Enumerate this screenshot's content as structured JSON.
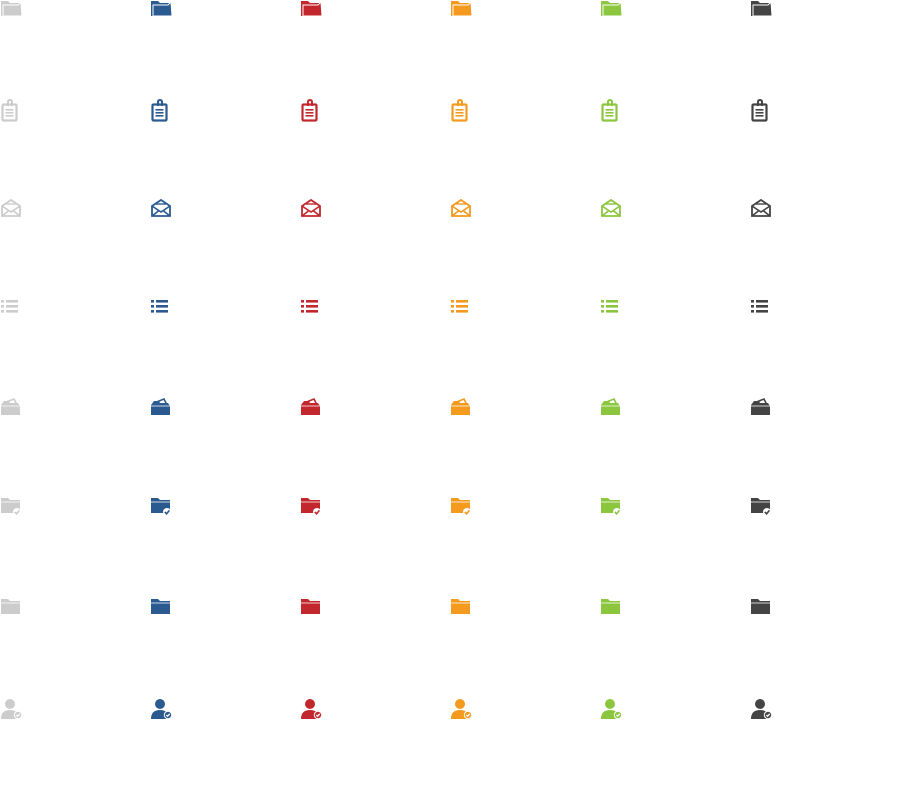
{
  "colors": [
    "#cccccc",
    "#2b5a91",
    "#c3272e",
    "#f39a1f",
    "#8cc63f",
    "#444444"
  ],
  "icon_rows": [
    "open-folder-icon",
    "clipboard-icon",
    "open-envelope-icon",
    "list-icon",
    "folder-tilted-icon",
    "folder-check-icon",
    "folder-icon",
    "user-check-icon"
  ]
}
